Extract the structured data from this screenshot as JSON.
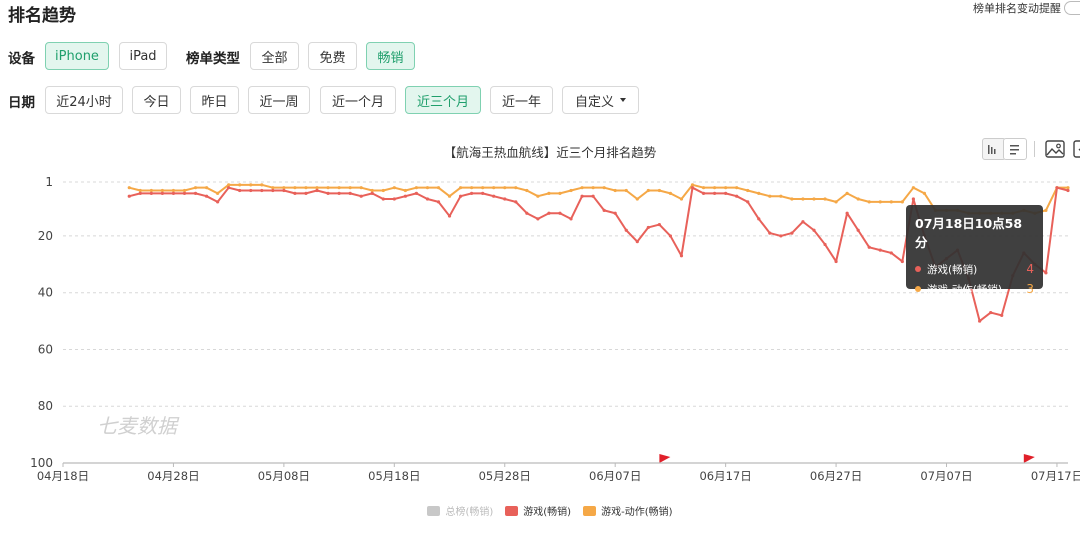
{
  "page_title": "排名趋势",
  "alert": {
    "label": "榜单排名变动提醒"
  },
  "device": {
    "label": "设备",
    "options": [
      {
        "label": "iPhone",
        "active": true
      },
      {
        "label": "iPad",
        "active": false
      }
    ]
  },
  "chart_type_filter": {
    "label": "榜单类型",
    "options": [
      {
        "label": "全部",
        "active": false
      },
      {
        "label": "免费",
        "active": false
      },
      {
        "label": "畅销",
        "active": true
      }
    ]
  },
  "date_filter": {
    "label": "日期",
    "options": [
      {
        "label": "近24小时",
        "active": false
      },
      {
        "label": "今日",
        "active": false
      },
      {
        "label": "昨日",
        "active": false
      },
      {
        "label": "近一周",
        "active": false
      },
      {
        "label": "近一个月",
        "active": false
      },
      {
        "label": "近三个月",
        "active": true
      },
      {
        "label": "近一年",
        "active": false
      }
    ],
    "custom_label": "自定义"
  },
  "chart_title": "【航海王热血航线】近三个月排名趋势",
  "watermark": "七麦数据",
  "tooltip": {
    "title": "07月18日10点58分",
    "rows": [
      {
        "name": "游戏(畅销)",
        "value": "4",
        "color": "#e8615a"
      },
      {
        "name": "游戏-动作(畅销)",
        "value": "3",
        "color": "#f5a847"
      }
    ]
  },
  "colors": {
    "accent": "#1f9f6c",
    "red": "#e8615a",
    "orange": "#f5a847",
    "flag": "#e0202a"
  },
  "chart_data": {
    "type": "line",
    "title": "【航海王热血航线】近三个月排名趋势",
    "y_inverted": true,
    "ylim": [
      1,
      100
    ],
    "y_ticks": [
      1,
      20,
      40,
      60,
      80,
      100
    ],
    "x_tick_labels": [
      "04月18日",
      "04月28日",
      "05月08日",
      "05月18日",
      "05月28日",
      "06月07日",
      "06月17日",
      "06月27日",
      "07月07日",
      "07月17日"
    ],
    "x_start": "04月18日",
    "x_end": "07月18日",
    "grid": true,
    "legend_position": "bottom",
    "event_flags": [
      "06月11日",
      "07月14日"
    ],
    "series": [
      {
        "name": "总榜(畅销)",
        "color": "#c8c8c8",
        "visible": false,
        "values": []
      },
      {
        "name": "游戏(畅销)",
        "color": "#e8615a",
        "visible": true,
        "values": [
          [
            "04月24日",
            6
          ],
          [
            "04月25日",
            5
          ],
          [
            "04月26日",
            5
          ],
          [
            "04月27日",
            5
          ],
          [
            "04月28日",
            5
          ],
          [
            "04月29日",
            5
          ],
          [
            "04月30日",
            5
          ],
          [
            "05月01日",
            6
          ],
          [
            "05月02日",
            8
          ],
          [
            "05月03日",
            3
          ],
          [
            "05月04日",
            4
          ],
          [
            "05月05日",
            4
          ],
          [
            "05月06日",
            4
          ],
          [
            "05月07日",
            4
          ],
          [
            "05月08日",
            4
          ],
          [
            "05月09日",
            5
          ],
          [
            "05月10日",
            5
          ],
          [
            "05月11日",
            4
          ],
          [
            "05月12日",
            5
          ],
          [
            "05月13日",
            5
          ],
          [
            "05月14日",
            5
          ],
          [
            "05月15日",
            6
          ],
          [
            "05月16日",
            5
          ],
          [
            "05月17日",
            7
          ],
          [
            "05月18日",
            7
          ],
          [
            "05月19日",
            6
          ],
          [
            "05月20日",
            5
          ],
          [
            "05月21日",
            7
          ],
          [
            "05月22日",
            8
          ],
          [
            "05月23日",
            13
          ],
          [
            "05月24日",
            6
          ],
          [
            "05月25日",
            5
          ],
          [
            "05月26日",
            5
          ],
          [
            "05月27日",
            6
          ],
          [
            "05月28日",
            7
          ],
          [
            "05月29日",
            8
          ],
          [
            "05月30日",
            12
          ],
          [
            "05月31日",
            14
          ],
          [
            "06月01日",
            12
          ],
          [
            "06月02日",
            12
          ],
          [
            "06月03日",
            14
          ],
          [
            "06月04日",
            6
          ],
          [
            "06月05日",
            6
          ],
          [
            "06月06日",
            11
          ],
          [
            "06月07日",
            12
          ],
          [
            "06月08日",
            18
          ],
          [
            "06月09日",
            22
          ],
          [
            "06月10日",
            17
          ],
          [
            "06月11日",
            16
          ],
          [
            "06月12日",
            20
          ],
          [
            "06月13日",
            27
          ],
          [
            "06月14日",
            3
          ],
          [
            "06月15日",
            5
          ],
          [
            "06月16日",
            5
          ],
          [
            "06月17日",
            5
          ],
          [
            "06月18日",
            6
          ],
          [
            "06月19日",
            8
          ],
          [
            "06月20日",
            14
          ],
          [
            "06月21日",
            19
          ],
          [
            "06月22日",
            20
          ],
          [
            "06月23日",
            19
          ],
          [
            "06月24日",
            15
          ],
          [
            "06月25日",
            18
          ],
          [
            "06月26日",
            23
          ],
          [
            "06月27日",
            29
          ],
          [
            "06月28日",
            12
          ],
          [
            "06月29日",
            18
          ],
          [
            "06月30日",
            24
          ],
          [
            "07月01日",
            25
          ],
          [
            "07月02日",
            26
          ],
          [
            "07月03日",
            29
          ],
          [
            "07月04日",
            7
          ],
          [
            "07月05日",
            20
          ],
          [
            "07月06日",
            31
          ],
          [
            "07月07日",
            28
          ],
          [
            "07月08日",
            25
          ],
          [
            "07月09日",
            35
          ],
          [
            "07月10日",
            50
          ],
          [
            "07月11日",
            47
          ],
          [
            "07月12日",
            48
          ],
          [
            "07月13日",
            34
          ],
          [
            "07月14日",
            26
          ],
          [
            "07月15日",
            30
          ],
          [
            "07月16日",
            33
          ],
          [
            "07月17日",
            3
          ],
          [
            "07月18日",
            4
          ]
        ]
      },
      {
        "name": "游戏-动作(畅销)",
        "color": "#f5a847",
        "visible": true,
        "values": [
          [
            "04月24日",
            3
          ],
          [
            "04月25日",
            4
          ],
          [
            "04月26日",
            4
          ],
          [
            "04月27日",
            4
          ],
          [
            "04月28日",
            4
          ],
          [
            "04月29日",
            4
          ],
          [
            "04月30日",
            3
          ],
          [
            "05月01日",
            3
          ],
          [
            "05月02日",
            5
          ],
          [
            "05月03日",
            2
          ],
          [
            "05月04日",
            2
          ],
          [
            "05月05日",
            2
          ],
          [
            "05月06日",
            2
          ],
          [
            "05月07日",
            3
          ],
          [
            "05月08日",
            3
          ],
          [
            "05月09日",
            3
          ],
          [
            "05月10日",
            3
          ],
          [
            "05月11日",
            3
          ],
          [
            "05月12日",
            3
          ],
          [
            "05月13日",
            3
          ],
          [
            "05月14日",
            3
          ],
          [
            "05月15日",
            3
          ],
          [
            "05月16日",
            4
          ],
          [
            "05月17日",
            4
          ],
          [
            "05月18日",
            3
          ],
          [
            "05月19日",
            4
          ],
          [
            "05月20日",
            3
          ],
          [
            "05月21日",
            3
          ],
          [
            "05月22日",
            3
          ],
          [
            "05月23日",
            6
          ],
          [
            "05月24日",
            3
          ],
          [
            "05月25日",
            3
          ],
          [
            "05月26日",
            3
          ],
          [
            "05月27日",
            3
          ],
          [
            "05月28日",
            3
          ],
          [
            "05月29日",
            3
          ],
          [
            "05月30日",
            4
          ],
          [
            "05月31日",
            6
          ],
          [
            "06月01日",
            5
          ],
          [
            "06月02日",
            5
          ],
          [
            "06月03日",
            4
          ],
          [
            "06月04日",
            3
          ],
          [
            "06月05日",
            3
          ],
          [
            "06月06日",
            3
          ],
          [
            "06月07日",
            4
          ],
          [
            "06月08日",
            4
          ],
          [
            "06月09日",
            7
          ],
          [
            "06月10日",
            4
          ],
          [
            "06月11日",
            4
          ],
          [
            "06月12日",
            5
          ],
          [
            "06月13日",
            7
          ],
          [
            "06月14日",
            2
          ],
          [
            "06月15日",
            3
          ],
          [
            "06月16日",
            3
          ],
          [
            "06月17日",
            3
          ],
          [
            "06月18日",
            3
          ],
          [
            "06月19日",
            4
          ],
          [
            "06月20日",
            5
          ],
          [
            "06月21日",
            6
          ],
          [
            "06月22日",
            6
          ],
          [
            "06月23日",
            7
          ],
          [
            "06月24日",
            7
          ],
          [
            "06月25日",
            7
          ],
          [
            "06月26日",
            7
          ],
          [
            "06月27日",
            8
          ],
          [
            "06月28日",
            5
          ],
          [
            "06月29日",
            7
          ],
          [
            "06月30日",
            8
          ],
          [
            "07月01日",
            8
          ],
          [
            "07月02日",
            8
          ],
          [
            "07月03日",
            8
          ],
          [
            "07月04日",
            3
          ],
          [
            "07月05日",
            5
          ],
          [
            "07月06日",
            11
          ],
          [
            "07月07日",
            11
          ],
          [
            "07月08日",
            11
          ],
          [
            "07月09日",
            12
          ],
          [
            "07月10日",
            12
          ],
          [
            "07月11日",
            12
          ],
          [
            "07月12日",
            12
          ],
          [
            "07月13日",
            12
          ],
          [
            "07月14日",
            11
          ],
          [
            "07月15日",
            12
          ],
          [
            "07月16日",
            11
          ],
          [
            "07月17日",
            3
          ],
          [
            "07月18日",
            3
          ]
        ]
      }
    ]
  }
}
